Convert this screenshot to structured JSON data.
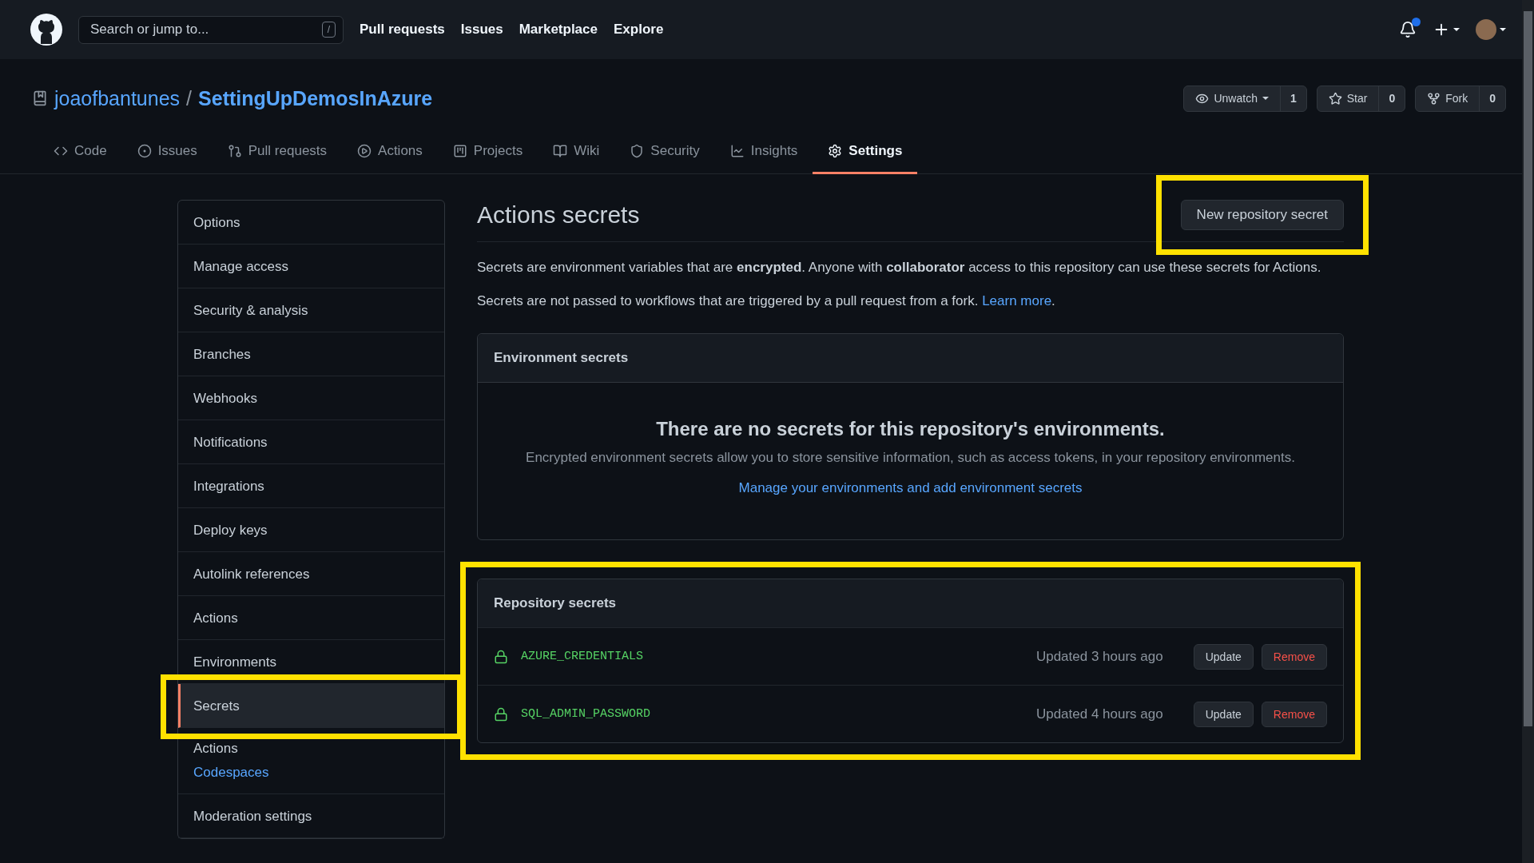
{
  "header": {
    "search_placeholder": "Search or jump to...",
    "search_key": "/",
    "nav": [
      "Pull requests",
      "Issues",
      "Marketplace",
      "Explore"
    ],
    "notifications_unread": true
  },
  "repo": {
    "owner": "joaofbantunes",
    "separator": "/",
    "name": "SettingUpDemosInAzure",
    "actions": [
      {
        "label": "Unwatch",
        "count": "1",
        "has_menu": true
      },
      {
        "label": "Star",
        "count": "0",
        "has_menu": false
      },
      {
        "label": "Fork",
        "count": "0",
        "has_menu": false
      }
    ]
  },
  "tabs": [
    {
      "label": "Code",
      "selected": false
    },
    {
      "label": "Issues",
      "selected": false
    },
    {
      "label": "Pull requests",
      "selected": false
    },
    {
      "label": "Actions",
      "selected": false
    },
    {
      "label": "Projects",
      "selected": false
    },
    {
      "label": "Wiki",
      "selected": false
    },
    {
      "label": "Security",
      "selected": false
    },
    {
      "label": "Insights",
      "selected": false
    },
    {
      "label": "Settings",
      "selected": true
    }
  ],
  "sidebar": {
    "items": [
      {
        "label": "Options",
        "selected": false,
        "highlighted": false
      },
      {
        "label": "Manage access",
        "selected": false,
        "highlighted": false
      },
      {
        "label": "Security & analysis",
        "selected": false,
        "highlighted": false
      },
      {
        "label": "Branches",
        "selected": false,
        "highlighted": false
      },
      {
        "label": "Webhooks",
        "selected": false,
        "highlighted": false
      },
      {
        "label": "Notifications",
        "selected": false,
        "highlighted": false
      },
      {
        "label": "Integrations",
        "selected": false,
        "highlighted": false
      },
      {
        "label": "Deploy keys",
        "selected": false,
        "highlighted": false
      },
      {
        "label": "Autolink references",
        "selected": false,
        "highlighted": false
      },
      {
        "label": "Actions",
        "selected": false,
        "highlighted": false
      },
      {
        "label": "Environments",
        "selected": false,
        "highlighted": false
      },
      {
        "label": "Secrets",
        "selected": true,
        "highlighted": true,
        "children": [
          {
            "label": "Actions",
            "selected": true
          },
          {
            "label": "Codespaces",
            "selected": false
          }
        ]
      },
      {
        "label": "Moderation settings",
        "selected": false,
        "highlighted": false
      }
    ]
  },
  "main": {
    "title": "Actions secrets",
    "new_button": {
      "label": "New repository secret",
      "highlighted": true
    },
    "intro": "Secrets are environment variables that are **encrypted**. Anyone with **collaborator** access to this repository can use these secrets for Actions.",
    "notice": {
      "text": "Secrets are not passed to workflows that are triggered by a pull request from a fork.",
      "link": "Learn more",
      "after": "."
    },
    "environment_secrets": {
      "title": "Environment secrets",
      "empty_title": "There are no secrets for this repository's environments.",
      "empty_text": "Encrypted environment secrets allow you to store sensitive information, such as access tokens, in your repository environments.",
      "link": "Manage your environments and add environment secrets"
    },
    "repository_secrets": {
      "title": "Repository secrets",
      "highlighted": true,
      "rows": [
        {
          "name": "AZURE_CREDENTIALS",
          "updated": "Updated 3 hours ago",
          "update": "Update",
          "remove": "Remove"
        },
        {
          "name": "SQL_ADMIN_PASSWORD",
          "updated": "Updated 4 hours ago",
          "update": "Update",
          "remove": "Remove"
        }
      ]
    }
  }
}
